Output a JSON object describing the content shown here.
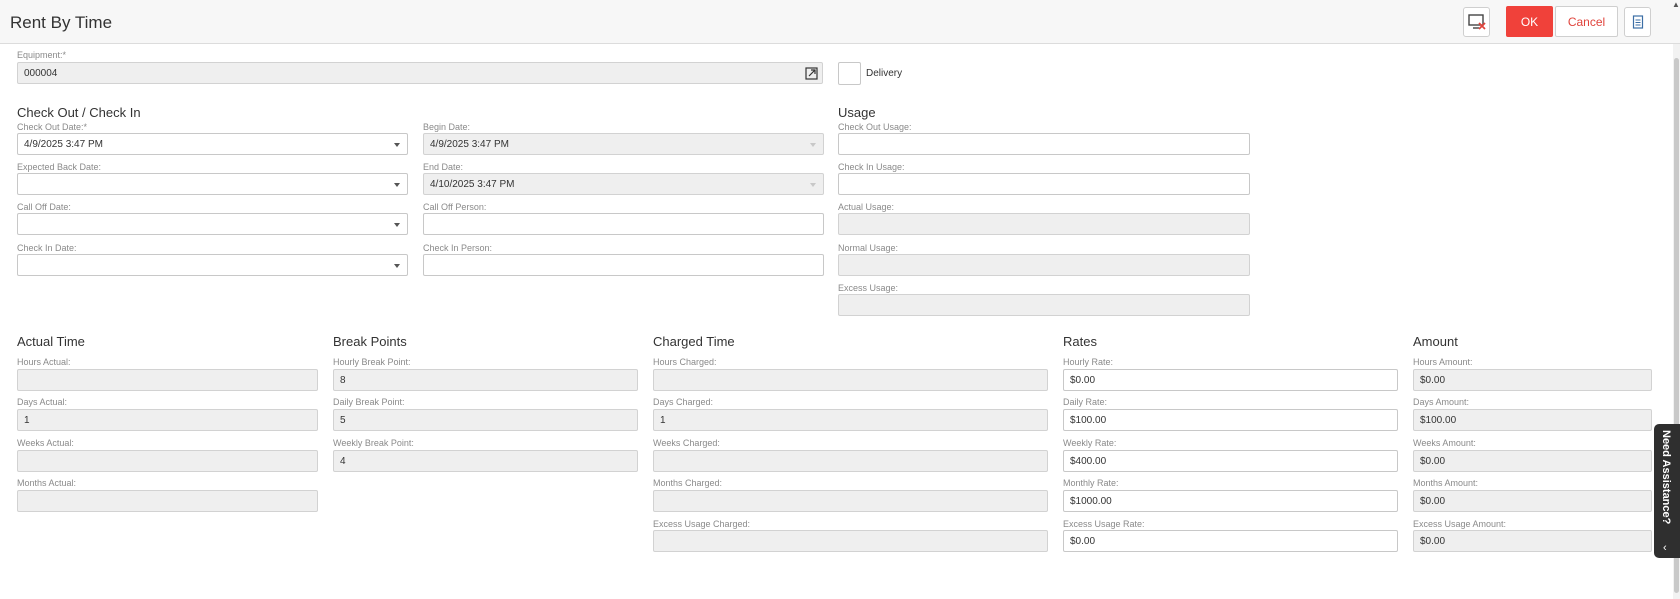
{
  "header": {
    "title": "Rent By Time",
    "ok_label": "OK",
    "cancel_label": "Cancel"
  },
  "equipment": {
    "label": "Equipment:*",
    "value": "000004"
  },
  "delivery": {
    "label": "Delivery",
    "checked": false
  },
  "checkout": {
    "title": "Check Out / Check In",
    "check_out_date": {
      "label": "Check Out Date:*",
      "value": "4/9/2025 3:47 PM"
    },
    "expected_back_date": {
      "label": "Expected Back Date:",
      "value": ""
    },
    "call_off_date": {
      "label": "Call Off Date:",
      "value": ""
    },
    "check_in_date": {
      "label": "Check In Date:",
      "value": ""
    },
    "begin_date": {
      "label": "Begin Date:",
      "value": "4/9/2025 3:47 PM"
    },
    "end_date": {
      "label": "End Date:",
      "value": "4/10/2025 3:47 PM"
    },
    "call_off_person": {
      "label": "Call Off Person:",
      "value": ""
    },
    "check_in_person": {
      "label": "Check In Person:",
      "value": ""
    }
  },
  "usage": {
    "title": "Usage",
    "check_out_usage": {
      "label": "Check Out Usage:",
      "value": ""
    },
    "check_in_usage": {
      "label": "Check In Usage:",
      "value": ""
    },
    "actual_usage": {
      "label": "Actual Usage:",
      "value": ""
    },
    "normal_usage": {
      "label": "Normal Usage:",
      "value": ""
    },
    "excess_usage": {
      "label": "Excess Usage:",
      "value": ""
    }
  },
  "actual_time": {
    "title": "Actual Time",
    "hours": {
      "label": "Hours Actual:",
      "value": ""
    },
    "days": {
      "label": "Days Actual:",
      "value": "1"
    },
    "weeks": {
      "label": "Weeks Actual:",
      "value": ""
    },
    "months": {
      "label": "Months Actual:",
      "value": ""
    }
  },
  "break_points": {
    "title": "Break Points",
    "hourly": {
      "label": "Hourly Break Point:",
      "value": "8"
    },
    "daily": {
      "label": "Daily Break Point:",
      "value": "5"
    },
    "weekly": {
      "label": "Weekly Break Point:",
      "value": "4"
    }
  },
  "charged_time": {
    "title": "Charged Time",
    "hours": {
      "label": "Hours Charged:",
      "value": ""
    },
    "days": {
      "label": "Days Charged:",
      "value": "1"
    },
    "weeks": {
      "label": "Weeks Charged:",
      "value": ""
    },
    "months": {
      "label": "Months Charged:",
      "value": ""
    },
    "excess": {
      "label": "Excess Usage Charged:",
      "value": ""
    }
  },
  "rates": {
    "title": "Rates",
    "hourly": {
      "label": "Hourly Rate:",
      "value": "$0.00"
    },
    "daily": {
      "label": "Daily Rate:",
      "value": "$100.00"
    },
    "weekly": {
      "label": "Weekly Rate:",
      "value": "$400.00"
    },
    "monthly": {
      "label": "Monthly Rate:",
      "value": "$1000.00"
    },
    "excess": {
      "label": "Excess Usage Rate:",
      "value": "$0.00"
    }
  },
  "amount": {
    "title": "Amount",
    "hours": {
      "label": "Hours Amount:",
      "value": "$0.00"
    },
    "days": {
      "label": "Days Amount:",
      "value": "$100.00"
    },
    "weeks": {
      "label": "Weeks Amount:",
      "value": "$0.00"
    },
    "months": {
      "label": "Months Amount:",
      "value": "$0.00"
    },
    "excess": {
      "label": "Excess Usage Amount:",
      "value": "$0.00"
    }
  },
  "assist": {
    "label": "Need Assistance?"
  },
  "colors": {
    "accent": "#f0413a",
    "cancel_text": "#e0443c",
    "readonly_bg": "#efefef",
    "assist_bg": "#2f2f2f"
  },
  "icons": [
    "remove-screen-icon",
    "lookup-icon",
    "document-icon",
    "dropdown-caret-icon",
    "chevron-left-icon",
    "scroll-up-arrow-icon"
  ]
}
